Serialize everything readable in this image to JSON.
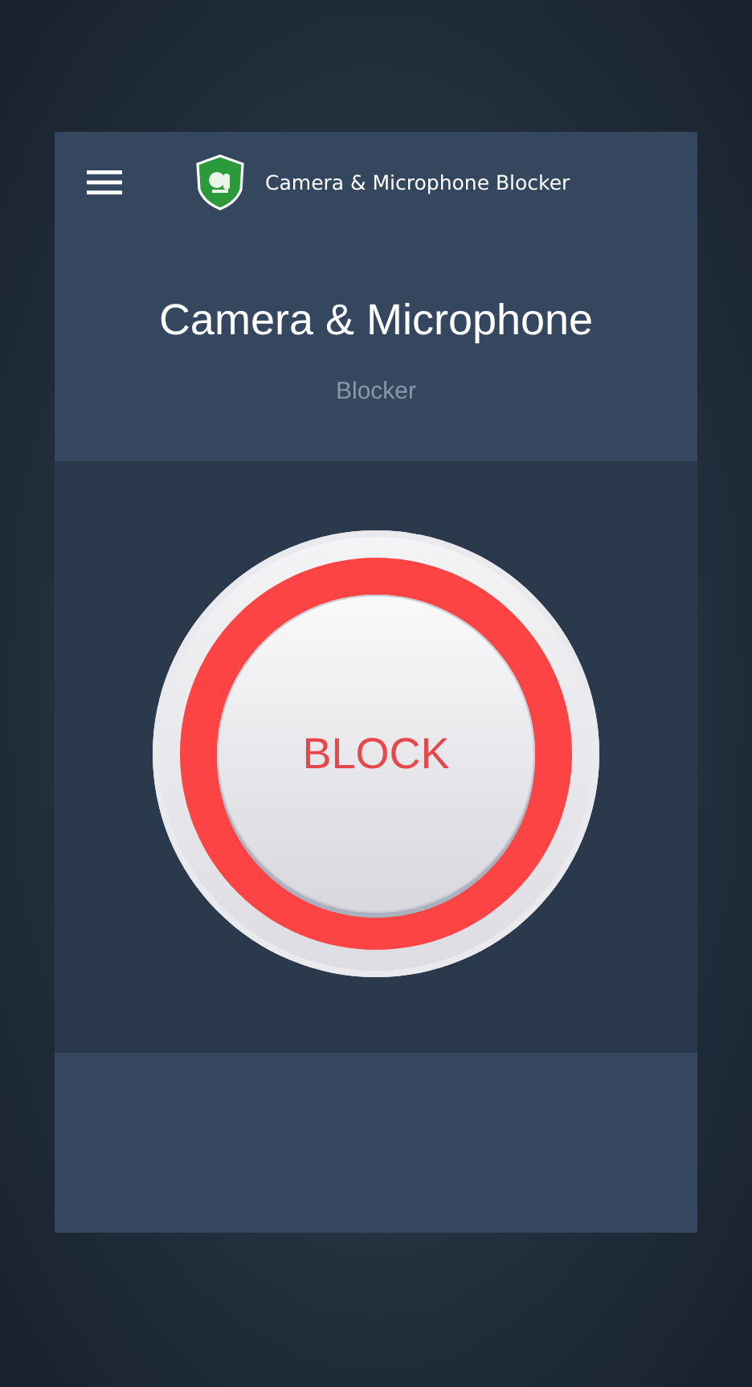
{
  "app_bar": {
    "title": "Camera & Microphone Blocker"
  },
  "header": {
    "title": "Camera & Microphone",
    "subtitle": "Blocker"
  },
  "block_button": {
    "label": "BLOCK"
  }
}
